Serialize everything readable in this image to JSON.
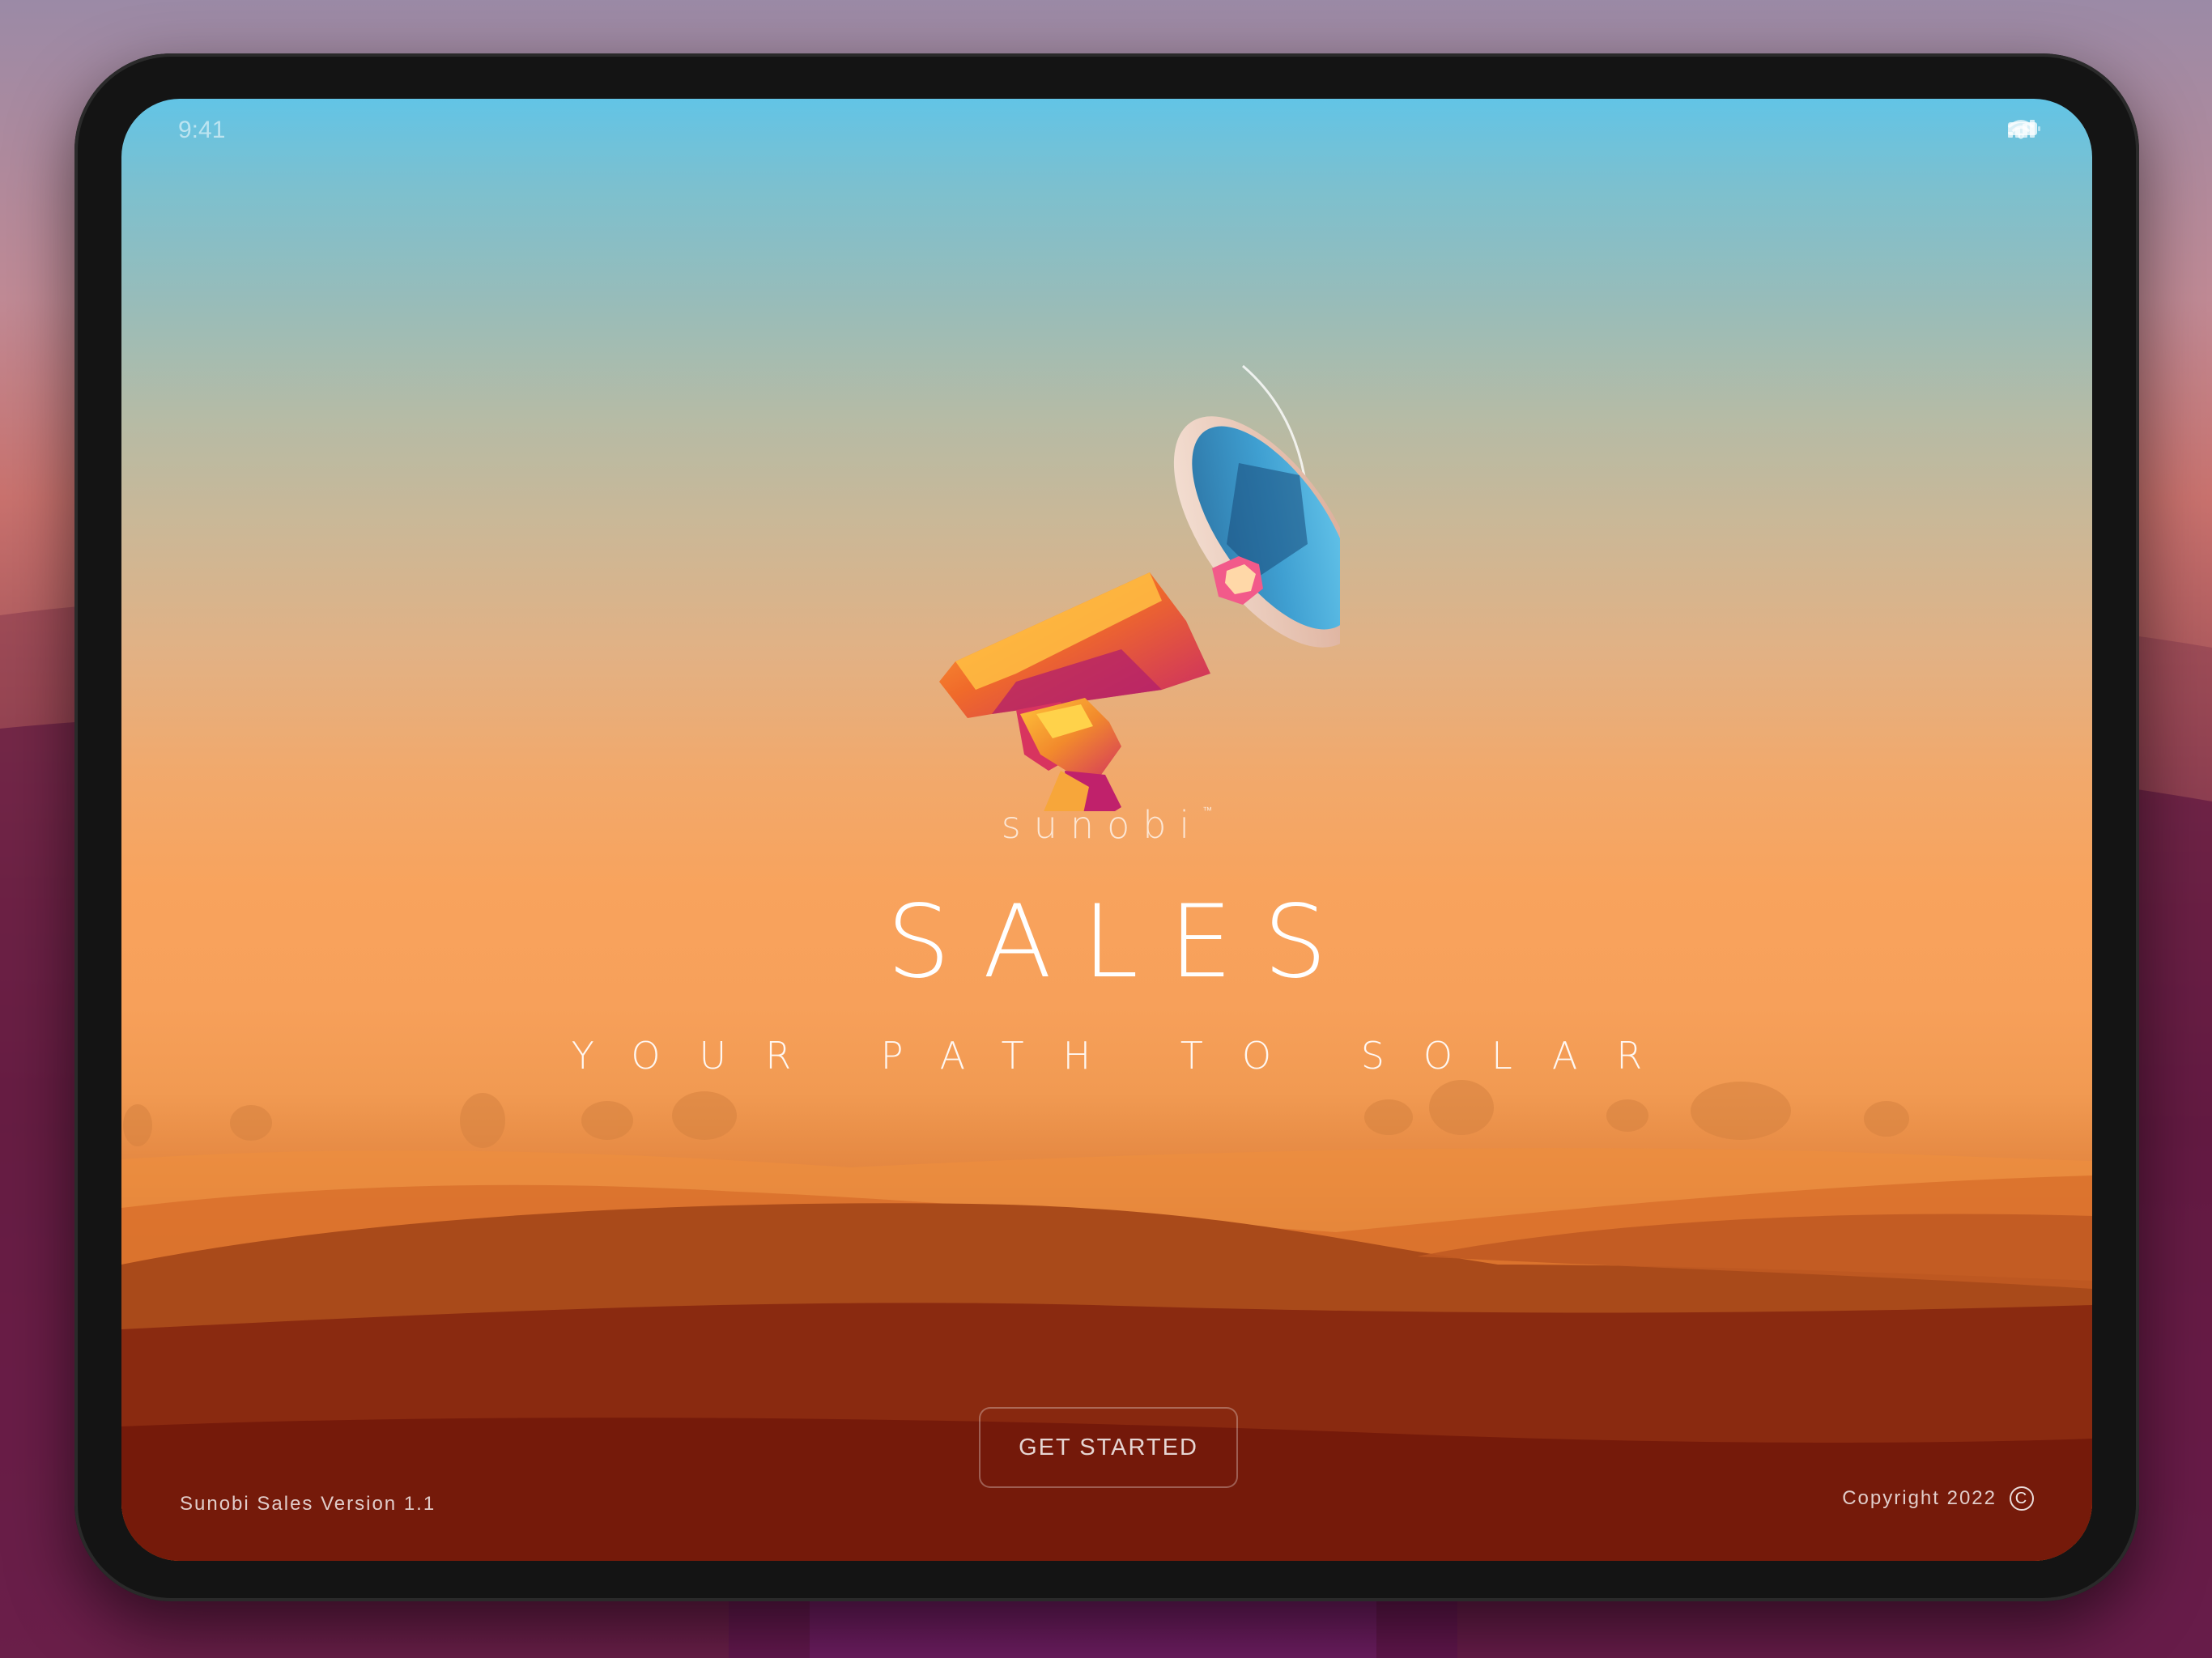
{
  "status_bar": {
    "time": "9:41",
    "icons": [
      "cellular-signal-icon",
      "wifi-icon",
      "battery-icon"
    ]
  },
  "hero": {
    "illustration": "megaphone-icon",
    "brand": "sunobi",
    "brand_mark": "™",
    "title": "SALES",
    "subtitle": "YOUR PATH TO SOLAR"
  },
  "cta": {
    "label": "GET STARTED"
  },
  "footer": {
    "version": "Sunobi Sales Version 1.1",
    "copyright": "Copyright 2022",
    "copyright_icon": "copyright-icon"
  },
  "colors": {
    "sky_top": "#62c4e6",
    "horizon": "#f8a35d",
    "ground": "#7c1d0c",
    "device_frame": "#141414",
    "text": "#ffffff"
  }
}
